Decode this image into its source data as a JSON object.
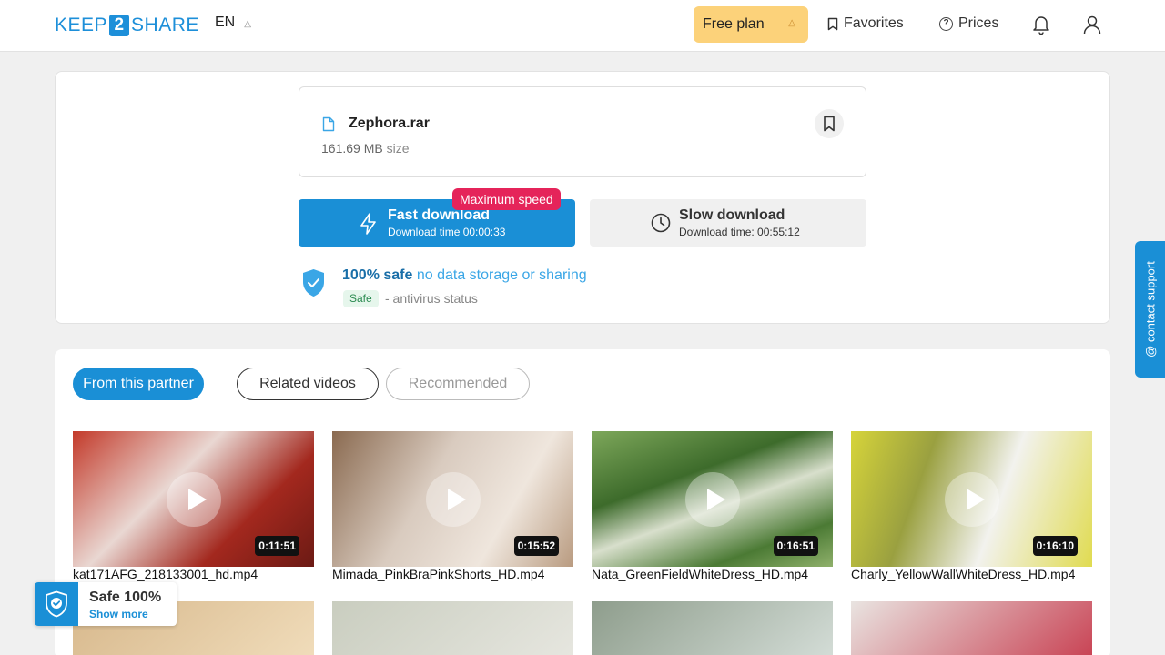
{
  "header": {
    "logo_left": "KEEP",
    "logo_mid": "2",
    "logo_right": "SHARE",
    "lang": "EN",
    "plan_label": "Free plan",
    "favorites_label": "Favorites",
    "prices_label": "Prices"
  },
  "file": {
    "name": "Zephora.rar",
    "size": "161.69 MB",
    "size_suffix": "size"
  },
  "download": {
    "fast_label": "Fast download",
    "fast_time": "Download time 00:00:33",
    "badge": "Maximum speed",
    "slow_label": "Slow download",
    "slow_time": "Download time: 00:55:12"
  },
  "safety": {
    "strong": "100% safe",
    "rest": "no data storage or sharing",
    "badge": "Safe",
    "desc": "- antivirus status"
  },
  "tabs": [
    {
      "label": "From this partner"
    },
    {
      "label": "Related videos"
    },
    {
      "label": "Recommended"
    }
  ],
  "videos": [
    {
      "title": "kat171AFG_218133001_hd.mp4",
      "duration": "0:11:51"
    },
    {
      "title": "Mimada_PinkBraPinkShorts_HD.mp4",
      "duration": "0:15:52"
    },
    {
      "title": "Nata_GreenFieldWhiteDress_HD.mp4",
      "duration": "0:16:51"
    },
    {
      "title": "Charly_YellowWallWhiteDress_HD.mp4",
      "duration": "0:16:10"
    }
  ],
  "contact_support": "@ contact support",
  "safe_widget": {
    "title": "Safe 100%",
    "link": "Show more"
  },
  "colors": {
    "accent": "#1a8fd6",
    "plan": "#fcd27a",
    "badge": "#e5245a"
  }
}
